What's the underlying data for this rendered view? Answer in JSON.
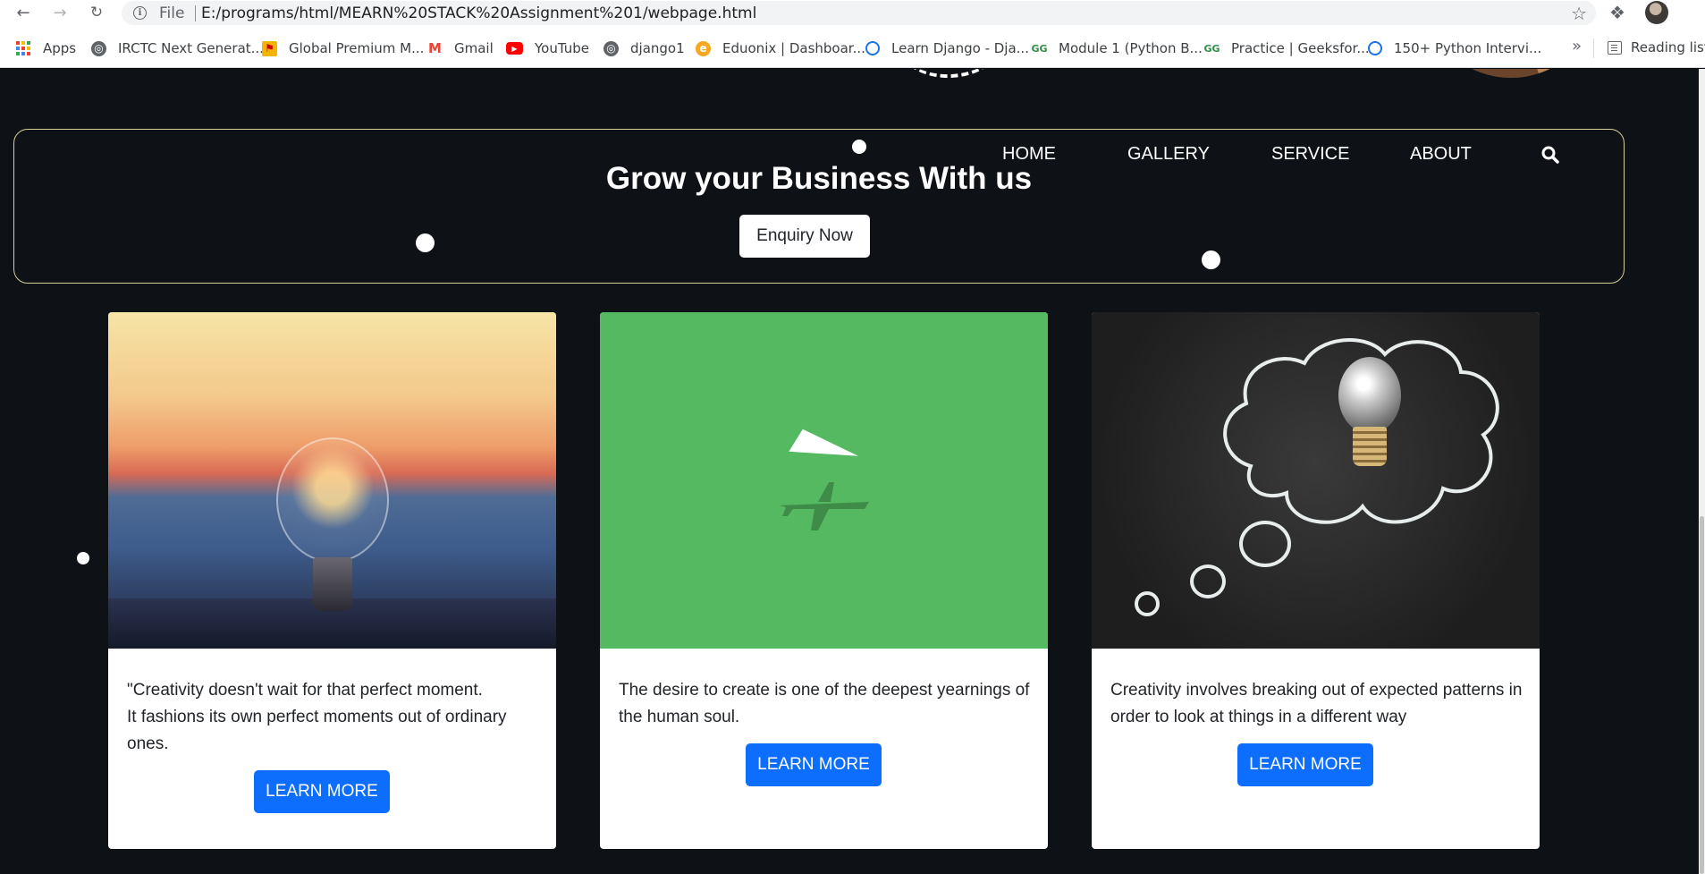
{
  "browser": {
    "scheme": "File",
    "url": "E:/programs/html/MEARN%20STACK%20Assignment%201/webpage.html",
    "bookmarks": [
      {
        "label": "Apps",
        "icon": "apps-grid-icon"
      },
      {
        "label": "IRCTC Next Generat...",
        "icon": "globe-icon"
      },
      {
        "label": "Global Premium M...",
        "icon": "flag-icon"
      },
      {
        "label": "Gmail",
        "icon": "gmail-icon"
      },
      {
        "label": "YouTube",
        "icon": "youtube-icon"
      },
      {
        "label": "django1",
        "icon": "globe-icon"
      },
      {
        "label": "Eduonix | Dashboar...",
        "icon": "eduonix-icon"
      },
      {
        "label": "Learn Django - Dja...",
        "icon": "link-icon"
      },
      {
        "label": "Module 1 (Python B...",
        "icon": "geeksforgeeks-icon"
      },
      {
        "label": "Practice | Geeksfor...",
        "icon": "geeksforgeeks-icon"
      },
      {
        "label": "150+ Python Intervi...",
        "icon": "link-icon"
      }
    ],
    "more_bookmarks": "»",
    "reading_list": "Reading list"
  },
  "banner": {
    "title": "Grow your Business With us",
    "enquiry_button": "Enquiry Now"
  },
  "nav": {
    "items": [
      "HOME",
      "GALLERY",
      "SERVICE",
      "ABOUT"
    ]
  },
  "cards": [
    {
      "image": "lightbulb-sunset",
      "lines": [
        "\"Creativity doesn't wait for that perfect moment.",
        "It fashions its own perfect moments out of ordinary ones."
      ],
      "button": "LEARN MORE"
    },
    {
      "image": "paper-plane-shadow",
      "lines": [
        "The desire to create is one of the deepest yearnings of the human soul."
      ],
      "button": "LEARN MORE"
    },
    {
      "image": "chalk-thought-bubble-bulb",
      "lines": [
        "Creativity involves breaking out of expected patterns in order to look at things in a different way"
      ],
      "button": "LEARN MORE"
    }
  ],
  "colors": {
    "page_bg": "#0e1116",
    "banner_border": "#d7cf9a",
    "button_primary": "#0d6efd",
    "card_bg": "#ffffff"
  }
}
